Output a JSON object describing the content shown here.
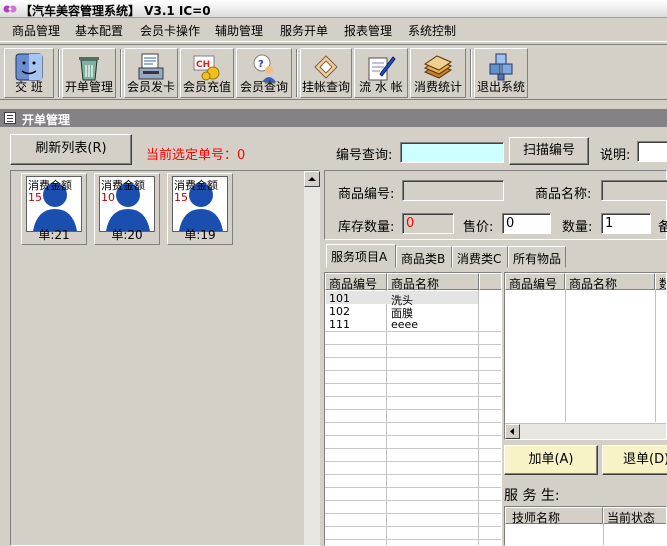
{
  "window": {
    "title": "【汽车美容管理系统】 V3.1 IC=0"
  },
  "menu": [
    "商品管理",
    "基本配置",
    "会员卡操作",
    "辅助管理",
    "服务开单",
    "报表管理",
    "系统控制"
  ],
  "toolbar": {
    "buttons": [
      {
        "label": "交  班",
        "icon": "finder-icon"
      },
      {
        "label": "开单管理",
        "icon": "recycle-bin-icon"
      },
      {
        "label": "会员发卡",
        "icon": "card-reader-icon"
      },
      {
        "label": "会员充值",
        "icon": "charge-card-icon"
      },
      {
        "label": "会员查询",
        "icon": "member-search-icon"
      },
      {
        "label": "挂帐查询",
        "icon": "ledger-icon"
      },
      {
        "label": "流 水 帐",
        "icon": "pen-paper-icon"
      },
      {
        "label": "消费统计",
        "icon": "books-icon"
      },
      {
        "label": "退出系统",
        "icon": "exit-cubes-icon"
      }
    ]
  },
  "child_window": {
    "title": "开单管理"
  },
  "orders": {
    "refresh_label": "刷新列表(R)",
    "current_label": "当前选定单号：0",
    "cards": [
      {
        "amount_label": "消费金额",
        "amount": "15",
        "number": "单:21"
      },
      {
        "amount_label": "消费金额",
        "amount": "10",
        "number": "单:20"
      },
      {
        "amount_label": "消费金额",
        "amount": "15",
        "number": "单:19"
      }
    ]
  },
  "search": {
    "code_label": "编号查询:",
    "code_value": "",
    "scan_button": "扫描编号",
    "note_label": "说明:",
    "note_value": ""
  },
  "product": {
    "code_label": "商品编号:",
    "code_value": "",
    "name_label": "商品名称:",
    "name_value": "",
    "stock_label": "库存数量:",
    "stock_value": "0",
    "price_label": "售价:",
    "price_value": "0",
    "qty_label": "数量:",
    "qty_value": "1",
    "extra_label": "备"
  },
  "tabs": [
    "服务项目A",
    "商品类B",
    "消费类C",
    "所有物品"
  ],
  "items_grid": {
    "columns": [
      "商品编号",
      "商品名称"
    ],
    "rows": [
      {
        "code": "101",
        "name": "洗头"
      },
      {
        "code": "102",
        "name": "面膜"
      },
      {
        "code": "111",
        "name": "eeee"
      }
    ]
  },
  "order_grid": {
    "columns": [
      "商品编号",
      "商品名称",
      "数"
    ]
  },
  "actions": {
    "add_label": "加单(A)",
    "remove_label": "退单(D)"
  },
  "staff": {
    "label": "服 务 生:",
    "columns": [
      "技师名称",
      "当前状态"
    ]
  }
}
